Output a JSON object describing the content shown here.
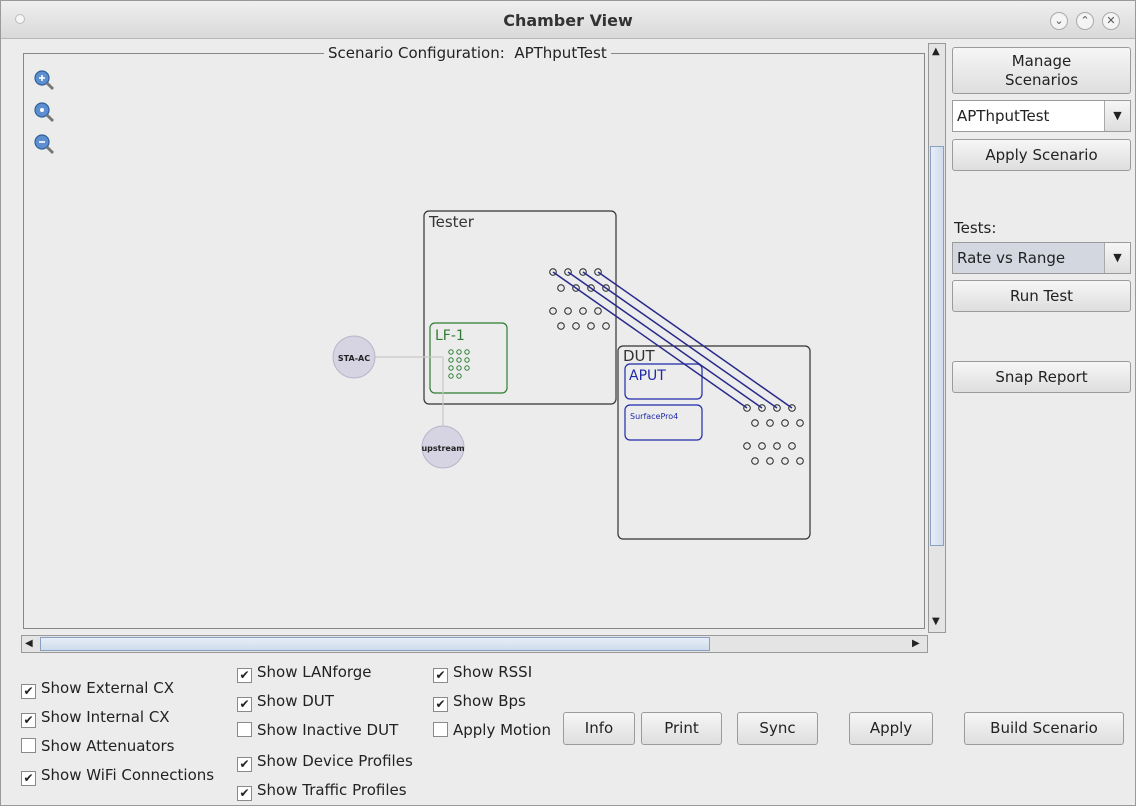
{
  "window": {
    "title": "Chamber View"
  },
  "scenario": {
    "legend_prefix": "Scenario Configuration:",
    "name": "APThputTest"
  },
  "diagram": {
    "tester_label": "Tester",
    "lf_label": "LF-1",
    "dut_label": "DUT",
    "aput_label": "APUT",
    "surface_label": "SurfacePro4",
    "sta_label": "STA-AC",
    "upstream_label": "upstream"
  },
  "sidebar": {
    "manage_line1": "Manage",
    "manage_line2": "Scenarios",
    "scenario_select": "APThputTest",
    "apply_scenario": "Apply Scenario",
    "tests_label": "Tests:",
    "tests_select": "Rate vs Range",
    "run_test": "Run Test",
    "snap_report": "Snap Report"
  },
  "options": {
    "col1": [
      {
        "label": "Show External CX",
        "checked": true
      },
      {
        "label": "Show Internal CX",
        "checked": true
      },
      {
        "label": "Show Attenuators",
        "checked": false
      },
      {
        "label": "Show WiFi Connections",
        "checked": true
      }
    ],
    "col2": [
      {
        "label": "Show LANforge",
        "checked": true
      },
      {
        "label": "Show DUT",
        "checked": true
      },
      {
        "label": "Show Inactive DUT",
        "checked": false
      },
      {
        "label": "Show Device Profiles",
        "checked": true
      },
      {
        "label": "Show Traffic Profiles",
        "checked": true
      }
    ],
    "col3": [
      {
        "label": "Show RSSI",
        "checked": true
      },
      {
        "label": "Show Bps",
        "checked": true
      },
      {
        "label": "Apply Motion",
        "checked": false
      }
    ]
  },
  "buttons": {
    "info": "Info",
    "print": "Print",
    "sync": "Sync",
    "apply": "Apply",
    "build": "Build Scenario"
  },
  "colors": {
    "tester_border": "#333333",
    "lf_green": "#2e7d32",
    "dut_blue": "#1f2aa8",
    "link_line": "#2a2a8a",
    "node_fill": "#d6d3e3"
  }
}
